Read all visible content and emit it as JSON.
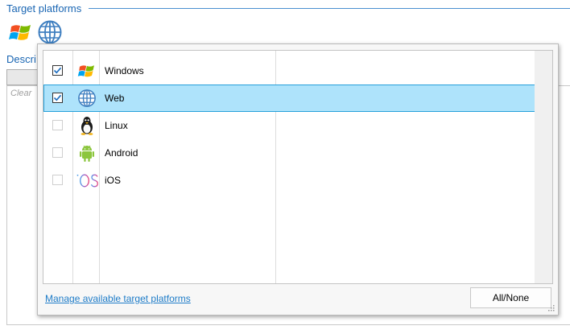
{
  "target_platforms": {
    "title": "Target platforms",
    "icons": [
      "windows-icon",
      "globe-icon"
    ]
  },
  "description": {
    "label": "Descri",
    "placeholder": "Clear"
  },
  "dropdown": {
    "items": [
      {
        "label": "Windows",
        "checked": true,
        "icon": "windows-icon"
      },
      {
        "label": "Web",
        "checked": true,
        "icon": "globe-icon",
        "selected": true
      },
      {
        "label": "Linux",
        "checked": false,
        "icon": "linux-icon"
      },
      {
        "label": "Android",
        "checked": false,
        "icon": "android-icon"
      },
      {
        "label": "iOS",
        "checked": false,
        "icon": "ios-icon"
      }
    ],
    "manage_link": "Manage available target platforms",
    "all_none": "All/None"
  },
  "colors": {
    "accent": "#1a66b3",
    "selection_bg": "#aee3fb",
    "selection_border": "#26a0da",
    "link": "#1e7cc8"
  }
}
